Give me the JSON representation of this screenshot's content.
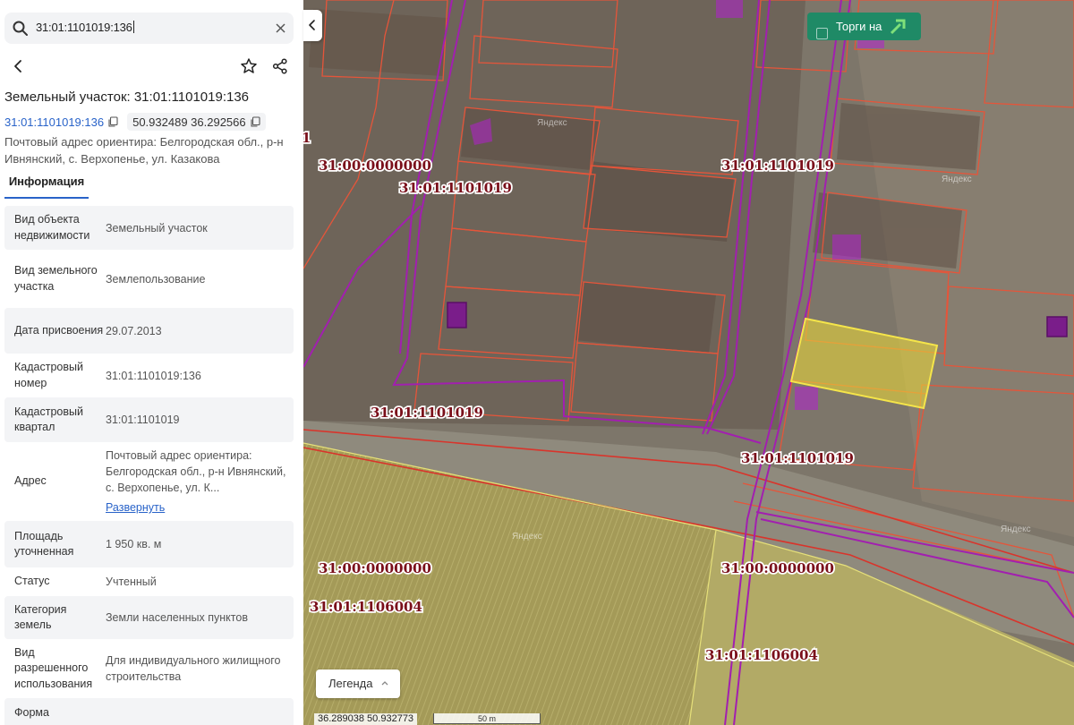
{
  "search": {
    "value": "31:01:1101019:136"
  },
  "object": {
    "title": "Земельный участок: 31:01:1101019:136",
    "cadastral_link": "31:01:1101019:136",
    "coords": "50.932489 36.292566",
    "postal_address": "Почтовый адрес ориентира: Белгородская обл., р-н Ивнянский, с. Верхопенье, ул. Казакова"
  },
  "tabs": {
    "info": "Информация"
  },
  "props": [
    {
      "key": "Вид объекта недвижимости",
      "value": "Земельный участок"
    },
    {
      "key": "Вид земельного участка",
      "value": "Землепользование"
    },
    {
      "key": "Дата присвоения",
      "value": "29.07.2013"
    },
    {
      "key": "Кадастровый номер",
      "value": "31:01:1101019:136"
    },
    {
      "key": "Кадастровый квартал",
      "value": "31:01:1101019"
    },
    {
      "key": "Адрес",
      "value": "Почтовый адрес ориентира: Белгородская обл., р-н Ивнянский, с. Верхопенье, ул. К...",
      "link": "Развернуть"
    },
    {
      "key": "Площадь уточненная",
      "value": "1 950 кв. м"
    },
    {
      "key": "Статус",
      "value": "Учтенный"
    },
    {
      "key": "Категория земель",
      "value": "Земли населенных пунктов"
    },
    {
      "key": "Вид разрешенного использования",
      "value": "Для индивидуального жилищного строительства"
    },
    {
      "key": "Форма",
      "value": ""
    }
  ],
  "map": {
    "torgi_label": "Торги на",
    "legend_label": "Легенда",
    "coord_readout": "36.289038 50.932773",
    "scale_label": "50 m",
    "watermark": "Яндекс",
    "labels": {
      "q_1101019": "31:01:1101019",
      "q_0000000": "31:00:0000000",
      "q_1106004": "31:01:1106004",
      "edge_fragment": "1"
    },
    "colors": {
      "parcel_border": "#e5553a",
      "quarter_border": "#a21fb0",
      "selected_fill": "#e6d33a",
      "zone_fill": "#b21fd0",
      "label": "#7a0f1a"
    }
  }
}
